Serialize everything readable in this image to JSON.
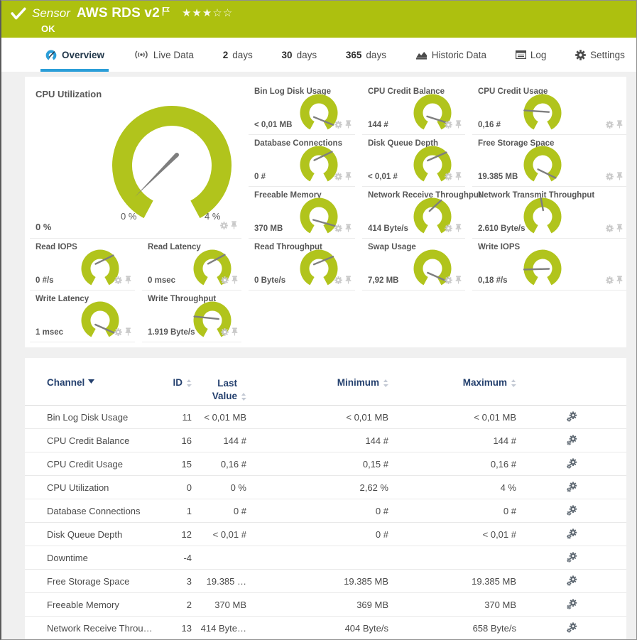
{
  "colors": {
    "page-bg": "#f0f0f0",
    "accent-green": "#adc00f",
    "gauge-green": "#b1c41c",
    "tab-blue": "#2b9ed8",
    "header-blue": "#24406e",
    "needle-gray": "#7e7e7e",
    "icon-light-gray": "#c9c9c9",
    "icon-dark-gray": "#4a4a4a"
  },
  "header": {
    "kicker": "Sensor",
    "title": "AWS RDS v2",
    "status": "OK",
    "rating": {
      "filled": 3,
      "total": 5
    }
  },
  "tabs": [
    {
      "id": "overview",
      "icon": "gauge",
      "label": "Overview",
      "active": true
    },
    {
      "id": "live-data",
      "icon": "live",
      "label": "Live Data",
      "active": false
    },
    {
      "id": "2-days",
      "num": "2",
      "label": "days",
      "active": false
    },
    {
      "id": "30-days",
      "num": "30",
      "label": "days",
      "active": false
    },
    {
      "id": "365-days",
      "num": "365",
      "label": "days",
      "active": false
    },
    {
      "id": "historic-data",
      "icon": "chart",
      "label": "Historic Data",
      "active": false
    },
    {
      "id": "log",
      "icon": "log",
      "label": "Log",
      "active": false
    },
    {
      "id": "settings",
      "icon": "gear",
      "label": "Settings",
      "active": false
    }
  ],
  "gauges": {
    "big": {
      "title": "CPU Utilization",
      "value": "0 %",
      "scale_min": "0 %",
      "scale_max": "4 %"
    },
    "small": [
      {
        "title": "Bin Log Disk Usage",
        "value": "< 0,01 MB",
        "needle_deg": -40
      },
      {
        "title": "CPU Credit Balance",
        "value": "144 #",
        "needle_deg": -33
      },
      {
        "title": "CPU Credit Usage",
        "value": "0,16 #",
        "needle_deg": 172
      },
      {
        "title": "Database Connections",
        "value": "0 #",
        "needle_deg": 45
      },
      {
        "title": "Disk Queue Depth",
        "value": "< 0,01 #",
        "needle_deg": 42
      },
      {
        "title": "Free Storage Space",
        "value": "19.385 MB",
        "needle_deg": -45
      },
      {
        "title": "Freeable Memory",
        "value": "370 MB",
        "needle_deg": -30
      },
      {
        "title": "Network Receive Throughput",
        "value": "414 Byte/s",
        "needle_deg": 62
      },
      {
        "title": "Network Transmit Throughput",
        "value": "2.610 Byte/s",
        "needle_deg": 95
      },
      {
        "title": "Read IOPS",
        "value": "0 #/s",
        "needle_deg": 45
      },
      {
        "title": "Read Latency",
        "value": "0 msec",
        "needle_deg": 48
      },
      {
        "title": "Read Throughput",
        "value": "0 Byte/s",
        "needle_deg": 40
      },
      {
        "title": "Swap Usage",
        "value": "7,92 MB",
        "needle_deg": -42
      },
      {
        "title": "Write IOPS",
        "value": "0,18 #/s",
        "needle_deg": 183
      },
      {
        "title": "Write Latency",
        "value": "1 msec",
        "needle_deg": -42
      },
      {
        "title": "Write Throughput",
        "value": "1.919 Byte/s",
        "needle_deg": 168
      }
    ]
  },
  "table": {
    "columns": [
      {
        "key": "channel",
        "label": "Channel",
        "sorted": true
      },
      {
        "key": "id",
        "label": "ID",
        "sorted": false
      },
      {
        "key": "last",
        "label": "Last Value",
        "sorted": false
      },
      {
        "key": "min",
        "label": "Minimum",
        "sorted": false
      },
      {
        "key": "max",
        "label": "Maximum",
        "sorted": false
      }
    ],
    "rows": [
      {
        "channel": "Bin Log Disk Usage",
        "id": "11",
        "last": "< 0,01 MB",
        "min": "< 0,01 MB",
        "max": "< 0,01 MB"
      },
      {
        "channel": "CPU Credit Balance",
        "id": "16",
        "last": "144 #",
        "min": "144 #",
        "max": "144 #"
      },
      {
        "channel": "CPU Credit Usage",
        "id": "15",
        "last": "0,16 #",
        "min": "0,15 #",
        "max": "0,16 #"
      },
      {
        "channel": "CPU Utilization",
        "id": "0",
        "last": "0 %",
        "min": "2,62 %",
        "max": "4 %"
      },
      {
        "channel": "Database Connections",
        "id": "1",
        "last": "0 #",
        "min": "0 #",
        "max": "0 #"
      },
      {
        "channel": "Disk Queue Depth",
        "id": "12",
        "last": "< 0,01 #",
        "min": "0 #",
        "max": "< 0,01 #"
      },
      {
        "channel": "Downtime",
        "id": "-4",
        "last": "",
        "min": "",
        "max": ""
      },
      {
        "channel": "Free Storage Space",
        "id": "3",
        "last": "19.385 …",
        "min": "19.385 MB",
        "max": "19.385 MB"
      },
      {
        "channel": "Freeable Memory",
        "id": "2",
        "last": "370 MB",
        "min": "369 MB",
        "max": "370 MB"
      },
      {
        "channel": "Network Receive Throu…",
        "id": "13",
        "last": "414 Byte…",
        "min": "404 Byte/s",
        "max": "658 Byte/s"
      }
    ]
  }
}
